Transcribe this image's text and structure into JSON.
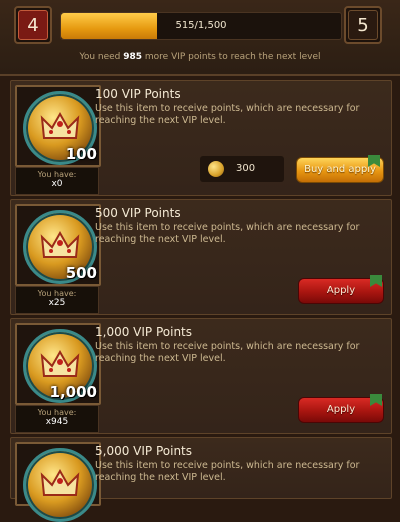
{
  "header": {
    "current_level": "4",
    "next_level": "5",
    "progress_text": "515/1,500",
    "progress_fraction": 0.343,
    "need_prefix": "You need ",
    "need_points": "985",
    "need_suffix": " more VIP points to reach the next level"
  },
  "items": [
    {
      "title": "100 VIP Points",
      "desc": "Use this item to receive points, which are necessary for reaching the next VIP level.",
      "badge": "100",
      "have_label": "You have:",
      "have_value": "x0",
      "price": "300",
      "button": "Buy and apply"
    },
    {
      "title": "500 VIP Points",
      "desc": "Use this item to receive points, which are necessary for reaching the next VIP level.",
      "badge": "500",
      "have_label": "You have:",
      "have_value": "x25",
      "button": "Apply"
    },
    {
      "title": "1,000 VIP Points",
      "desc": "Use this item to receive points, which are necessary for reaching the next VIP level.",
      "badge": "1,000",
      "have_label": "You have:",
      "have_value": "x945",
      "button": "Apply"
    },
    {
      "title": "5,000 VIP Points",
      "desc": "Use this item to receive points, which are necessary for reaching the next VIP level."
    }
  ],
  "colors": {
    "accent_gold": "#e69a10",
    "apply_red": "#a81510",
    "level_red": "#7a1a14"
  },
  "icons": [
    "vip-coin-icon",
    "crown-icon",
    "gold-coin-icon",
    "ribbon-flag-icon"
  ]
}
